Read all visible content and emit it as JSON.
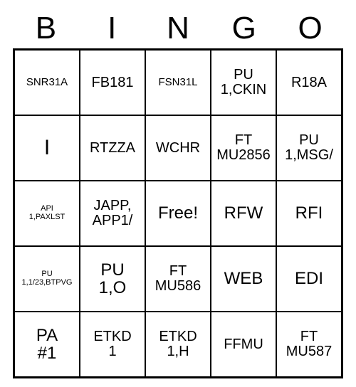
{
  "header": [
    "B",
    "I",
    "N",
    "G",
    "O"
  ],
  "cells": [
    {
      "text": "SNR31A",
      "size": "sm"
    },
    {
      "text": "FB181",
      "size": "md"
    },
    {
      "text": "FSN31L",
      "size": "sm"
    },
    {
      "text": "PU\n1,CKIN",
      "size": "md"
    },
    {
      "text": "R18A",
      "size": "md"
    },
    {
      "text": "I",
      "size": "xl"
    },
    {
      "text": "RTZZA",
      "size": "md"
    },
    {
      "text": "WCHR",
      "size": "md"
    },
    {
      "text": "FT\nMU2856",
      "size": "md"
    },
    {
      "text": "PU\n1,MSG/",
      "size": "md"
    },
    {
      "text": "API\n1,PAXLST",
      "size": "xs"
    },
    {
      "text": "JAPP,\nAPP1/",
      "size": "md"
    },
    {
      "text": "Free!",
      "size": "lg"
    },
    {
      "text": "RFW",
      "size": "lg"
    },
    {
      "text": "RFI",
      "size": "lg"
    },
    {
      "text": "PU\n1,1/23,BTPVG",
      "size": "xs"
    },
    {
      "text": "PU\n1,O",
      "size": "lg"
    },
    {
      "text": "FT\nMU586",
      "size": "md"
    },
    {
      "text": "WEB",
      "size": "lg"
    },
    {
      "text": "EDI",
      "size": "lg"
    },
    {
      "text": "PA\n#1",
      "size": "lg"
    },
    {
      "text": "ETKD\n1",
      "size": "md"
    },
    {
      "text": "ETKD\n1,H",
      "size": "md"
    },
    {
      "text": "FFMU",
      "size": "md"
    },
    {
      "text": "FT\nMU587",
      "size": "md"
    }
  ]
}
